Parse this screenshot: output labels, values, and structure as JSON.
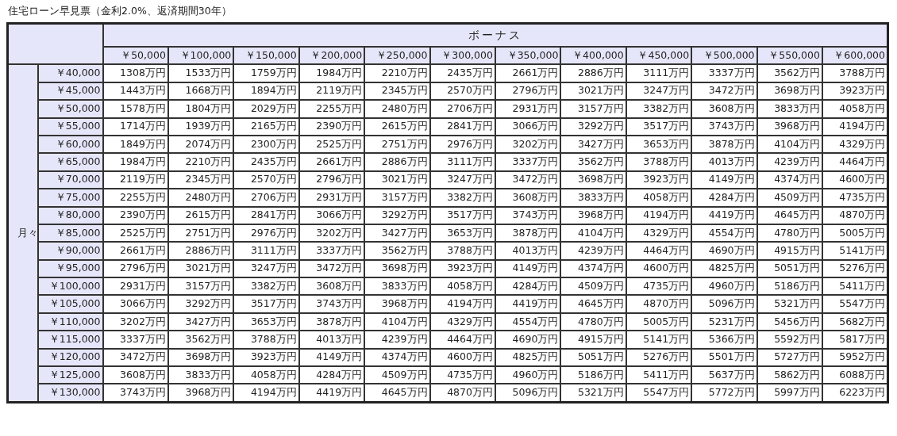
{
  "title": "住宅ローン早見票（金利2.0%、返済期間30年）",
  "table": {
    "bonus_label": "ボーナス",
    "monthly_label": "月々",
    "bonus_amounts": [
      "￥50,000",
      "￥100,000",
      "￥150,000",
      "￥200,000",
      "￥250,000",
      "￥300,000",
      "￥350,000",
      "￥400,000",
      "￥450,000",
      "￥500,000",
      "￥550,000",
      "￥600,000"
    ],
    "rows": [
      {
        "monthly": "￥40,000",
        "cells": [
          "1308万円",
          "1533万円",
          "1759万円",
          "1984万円",
          "2210万円",
          "2435万円",
          "2661万円",
          "2886万円",
          "3111万円",
          "3337万円",
          "3562万円",
          "3788万円"
        ]
      },
      {
        "monthly": "￥45,000",
        "cells": [
          "1443万円",
          "1668万円",
          "1894万円",
          "2119万円",
          "2345万円",
          "2570万円",
          "2796万円",
          "3021万円",
          "3247万円",
          "3472万円",
          "3698万円",
          "3923万円"
        ]
      },
      {
        "monthly": "￥50,000",
        "cells": [
          "1578万円",
          "1804万円",
          "2029万円",
          "2255万円",
          "2480万円",
          "2706万円",
          "2931万円",
          "3157万円",
          "3382万円",
          "3608万円",
          "3833万円",
          "4058万円"
        ]
      },
      {
        "monthly": "￥55,000",
        "cells": [
          "1714万円",
          "1939万円",
          "2165万円",
          "2390万円",
          "2615万円",
          "2841万円",
          "3066万円",
          "3292万円",
          "3517万円",
          "3743万円",
          "3968万円",
          "4194万円"
        ]
      },
      {
        "monthly": "￥60,000",
        "cells": [
          "1849万円",
          "2074万円",
          "2300万円",
          "2525万円",
          "2751万円",
          "2976万円",
          "3202万円",
          "3427万円",
          "3653万円",
          "3878万円",
          "4104万円",
          "4329万円"
        ]
      },
      {
        "monthly": "￥65,000",
        "cells": [
          "1984万円",
          "2210万円",
          "2435万円",
          "2661万円",
          "2886万円",
          "3111万円",
          "3337万円",
          "3562万円",
          "3788万円",
          "4013万円",
          "4239万円",
          "4464万円"
        ]
      },
      {
        "monthly": "￥70,000",
        "cells": [
          "2119万円",
          "2345万円",
          "2570万円",
          "2796万円",
          "3021万円",
          "3247万円",
          "3472万円",
          "3698万円",
          "3923万円",
          "4149万円",
          "4374万円",
          "4600万円"
        ]
      },
      {
        "monthly": "￥75,000",
        "cells": [
          "2255万円",
          "2480万円",
          "2706万円",
          "2931万円",
          "3157万円",
          "3382万円",
          "3608万円",
          "3833万円",
          "4058万円",
          "4284万円",
          "4509万円",
          "4735万円"
        ]
      },
      {
        "monthly": "￥80,000",
        "cells": [
          "2390万円",
          "2615万円",
          "2841万円",
          "3066万円",
          "3292万円",
          "3517万円",
          "3743万円",
          "3968万円",
          "4194万円",
          "4419万円",
          "4645万円",
          "4870万円"
        ]
      },
      {
        "monthly": "￥85,000",
        "cells": [
          "2525万円",
          "2751万円",
          "2976万円",
          "3202万円",
          "3427万円",
          "3653万円",
          "3878万円",
          "4104万円",
          "4329万円",
          "4554万円",
          "4780万円",
          "5005万円"
        ]
      },
      {
        "monthly": "￥90,000",
        "cells": [
          "2661万円",
          "2886万円",
          "3111万円",
          "3337万円",
          "3562万円",
          "3788万円",
          "4013万円",
          "4239万円",
          "4464万円",
          "4690万円",
          "4915万円",
          "5141万円"
        ]
      },
      {
        "monthly": "￥95,000",
        "cells": [
          "2796万円",
          "3021万円",
          "3247万円",
          "3472万円",
          "3698万円",
          "3923万円",
          "4149万円",
          "4374万円",
          "4600万円",
          "4825万円",
          "5051万円",
          "5276万円"
        ]
      },
      {
        "monthly": "￥100,000",
        "cells": [
          "2931万円",
          "3157万円",
          "3382万円",
          "3608万円",
          "3833万円",
          "4058万円",
          "4284万円",
          "4509万円",
          "4735万円",
          "4960万円",
          "5186万円",
          "5411万円"
        ]
      },
      {
        "monthly": "￥105,000",
        "cells": [
          "3066万円",
          "3292万円",
          "3517万円",
          "3743万円",
          "3968万円",
          "4194万円",
          "4419万円",
          "4645万円",
          "4870万円",
          "5096万円",
          "5321万円",
          "5547万円"
        ]
      },
      {
        "monthly": "￥110,000",
        "cells": [
          "3202万円",
          "3427万円",
          "3653万円",
          "3878万円",
          "4104万円",
          "4329万円",
          "4554万円",
          "4780万円",
          "5005万円",
          "5231万円",
          "5456万円",
          "5682万円"
        ]
      },
      {
        "monthly": "￥115,000",
        "cells": [
          "3337万円",
          "3562万円",
          "3788万円",
          "4013万円",
          "4239万円",
          "4464万円",
          "4690万円",
          "4915万円",
          "5141万円",
          "5366万円",
          "5592万円",
          "5817万円"
        ]
      },
      {
        "monthly": "￥120,000",
        "cells": [
          "3472万円",
          "3698万円",
          "3923万円",
          "4149万円",
          "4374万円",
          "4600万円",
          "4825万円",
          "5051万円",
          "5276万円",
          "5501万円",
          "5727万円",
          "5952万円"
        ]
      },
      {
        "monthly": "￥125,000",
        "cells": [
          "3608万円",
          "3833万円",
          "4058万円",
          "4284万円",
          "4509万円",
          "4735万円",
          "4960万円",
          "5186万円",
          "5411万円",
          "5637万円",
          "5862万円",
          "6088万円"
        ]
      },
      {
        "monthly": "￥130,000",
        "cells": [
          "3743万円",
          "3968万円",
          "4194万円",
          "4419万円",
          "4645万円",
          "4870万円",
          "5096万円",
          "5321万円",
          "5547万円",
          "5772万円",
          "5997万円",
          "6223万円"
        ]
      }
    ]
  }
}
